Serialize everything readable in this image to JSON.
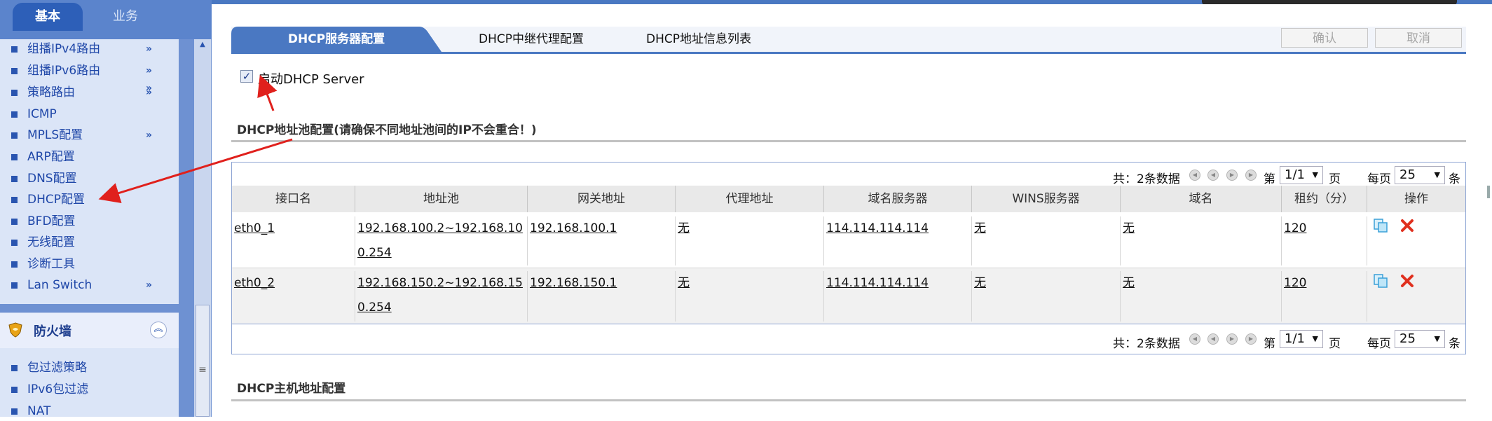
{
  "sidebar": {
    "tabs": {
      "basic": "基本",
      "business": "业务"
    },
    "items": [
      {
        "label": "组播IPv4路由",
        "expand": "»"
      },
      {
        "label": "组播IPv6路由",
        "expand": "»"
      },
      {
        "label": "策略路由",
        "expand": "»"
      },
      {
        "label": "ICMP",
        "expand": ""
      },
      {
        "label": "MPLS配置",
        "expand": "»"
      },
      {
        "label": "ARP配置",
        "expand": ""
      },
      {
        "label": "DNS配置",
        "expand": ""
      },
      {
        "label": "DHCP配置",
        "expand": ""
      },
      {
        "label": "BFD配置",
        "expand": ""
      },
      {
        "label": "无线配置",
        "expand": ""
      },
      {
        "label": "诊断工具",
        "expand": ""
      },
      {
        "label": "Lan Switch",
        "expand": "»"
      }
    ],
    "firewall": {
      "title": "防火墙",
      "items": [
        {
          "label": "包过滤策略"
        },
        {
          "label": "IPv6包过滤"
        },
        {
          "label": "NAT"
        }
      ]
    }
  },
  "tabs": {
    "server": "DHCP服务器配置",
    "relay": "DHCP中继代理配置",
    "list": "DHCP地址信息列表"
  },
  "buttons": {
    "confirm": "确认",
    "cancel": "取消"
  },
  "enable": {
    "label": "启动DHCP Server",
    "checked": true
  },
  "pool_section": {
    "title": "DHCP地址池配置(请确保不同地址池间的IP不会重合！)"
  },
  "host_section": {
    "title": "DHCP主机地址配置"
  },
  "pager": {
    "total_prefix": "共：",
    "total_text": "2条数据",
    "page_prefix": "第",
    "page_value": "1/1",
    "page_suffix": "页",
    "per_page_prefix": "每页",
    "per_page_value": "25",
    "per_page_suffix": "条"
  },
  "table": {
    "headers": [
      "接口名",
      "地址池",
      "网关地址",
      "代理地址",
      "域名服务器",
      "WINS服务器",
      "域名",
      "租约（分）",
      "操作"
    ],
    "rows": [
      {
        "iface": "eth0_1",
        "pool_l1": "192.168.100.2~192.168.10",
        "pool_l2": "0.254",
        "gateway": "192.168.100.1",
        "proxy": "无",
        "dns": "114.114.114.114",
        "wins": "无",
        "domain": "无",
        "lease": "120"
      },
      {
        "iface": "eth0_2",
        "pool_l1": "192.168.150.2~192.168.15",
        "pool_l2": "0.254",
        "gateway": "192.168.150.1",
        "proxy": "无",
        "dns": "114.114.114.114",
        "wins": "无",
        "domain": "无",
        "lease": "120"
      }
    ]
  },
  "colors": {
    "accent": "#4a78c2",
    "annotation": "#e0201c",
    "link": "#1f47a8"
  }
}
